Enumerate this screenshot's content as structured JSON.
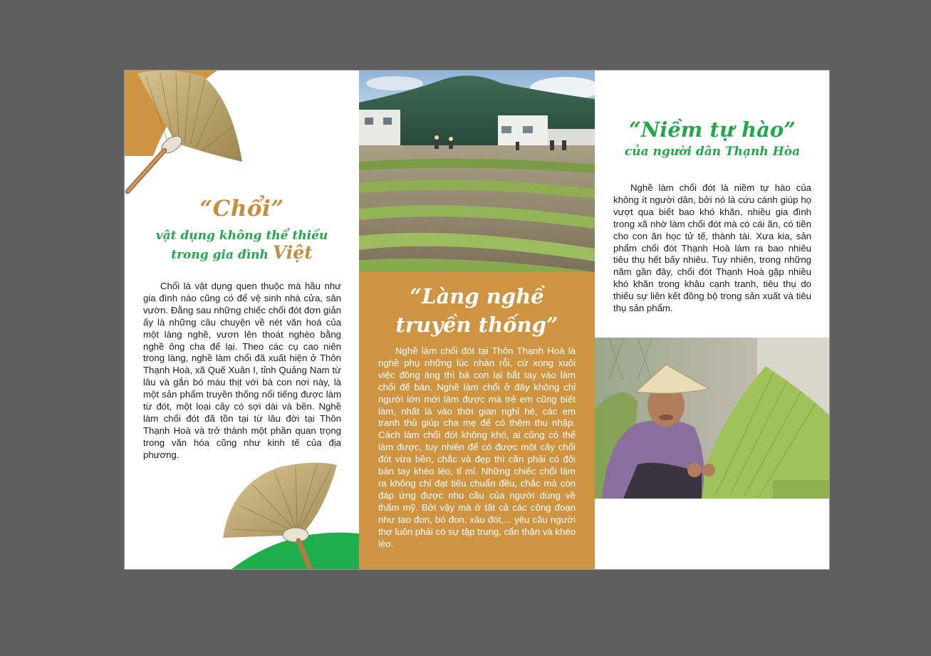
{
  "panel_left": {
    "title": "“Chổi”",
    "subtitle_line1": "vật dụng không thể thiếu",
    "subtitle_line2": "trong gia đình",
    "subtitle_emphasis": "Việt",
    "body": "Chổi là vật dụng quen thuộc mà hầu như gia đình nào cũng có để vệ sinh nhà cửa, sân vườn. Đằng sau những chiếc chổi đót đơn giản ấy là những câu chuyện về nét văn hoá của một làng nghề, vươn lên thoát nghèo bằng nghề ông cha để lại. Theo các cụ cao niên trong làng, nghề làm chổi đã xuất hiện ở Thôn Thạnh Hoà, xã Quế Xuân I, tỉnh Quảng Nam từ lâu và gắn bó máu thịt với bà con nơi này, là một sản phẩm truyền thống nổi tiếng được làm từ đót, một loại cây có sợi dài và bền. Nghề làm chổi đót đã tồn tại từ lâu đời tại Thôn Thạnh Hoà và trở thành một phần quan trọng trong văn hóa cũng như kinh tế của địa phương."
  },
  "panel_middle": {
    "title_line1": "“Làng nghề",
    "title_line2": "truyền thống”",
    "body": "Nghề làm chổi đót tại Thôn Thạnh Hoà là nghề phụ những lúc nhàn rỗi, cứ xong xuôi việc đồng áng thì bà con lại bắt tay vào làm chổi để bán. Nghề làm chổi ở đây không chỉ người lớn mới làm được mà trẻ em cũng biết làm, nhất là vào thời gian nghỉ hè, các em tranh thủ giúp cha mẹ để có thêm thu nhập. Cách làm chổi đót không khó, ai cũng có thể làm được, tuy nhiên để có được một cây chổi đót vừa bền, chắc và đẹp thì cần phải có đôi bàn tay khéo léo, tỉ mỉ. Những chiếc chổi làm ra không chỉ đạt tiêu chuẩn đều, chắc mà còn đáp ứng được nhu cầu của người dùng về thẩm mỹ. Bởi vậy mà ở tất cả các công đoạn như tạo đon, bó đon, xâu đót,... yêu cầu người thợ luôn phải có sự tập trung, cẩn thận và khéo léo."
  },
  "panel_right": {
    "title": "“Niềm tự hào”",
    "subtitle": "của người dân Thạnh Hòa",
    "body": "Nghề làm chổi đót là niềm tự hào của không ít người dân, bởi nó là cứu cánh giúp họ vượt qua biết bao khó khăn, nhiều gia đình trong xã nhờ làm chổi đót mà có cái ăn, có tiền cho con ăn học tử tế, thành tài. Xưa kia, sản phẩm chổi đót Thạnh Hoà làm ra bao nhiêu tiêu thụ hết bấy nhiêu. Tuy nhiên, trong những năm gần đây, chổi đót Thạnh Hoà gặp nhiều khó khăn trong khâu cạnh tranh, tiêu thụ do thiếu sự liên kết đồng bộ trong sản xuất và tiêu thụ sản phẩm."
  },
  "colors": {
    "brand_green": "#22a84b",
    "brand_tan": "#c98b3d",
    "panel_orange": "#cf9442",
    "backdrop": "#5f5f5f"
  }
}
